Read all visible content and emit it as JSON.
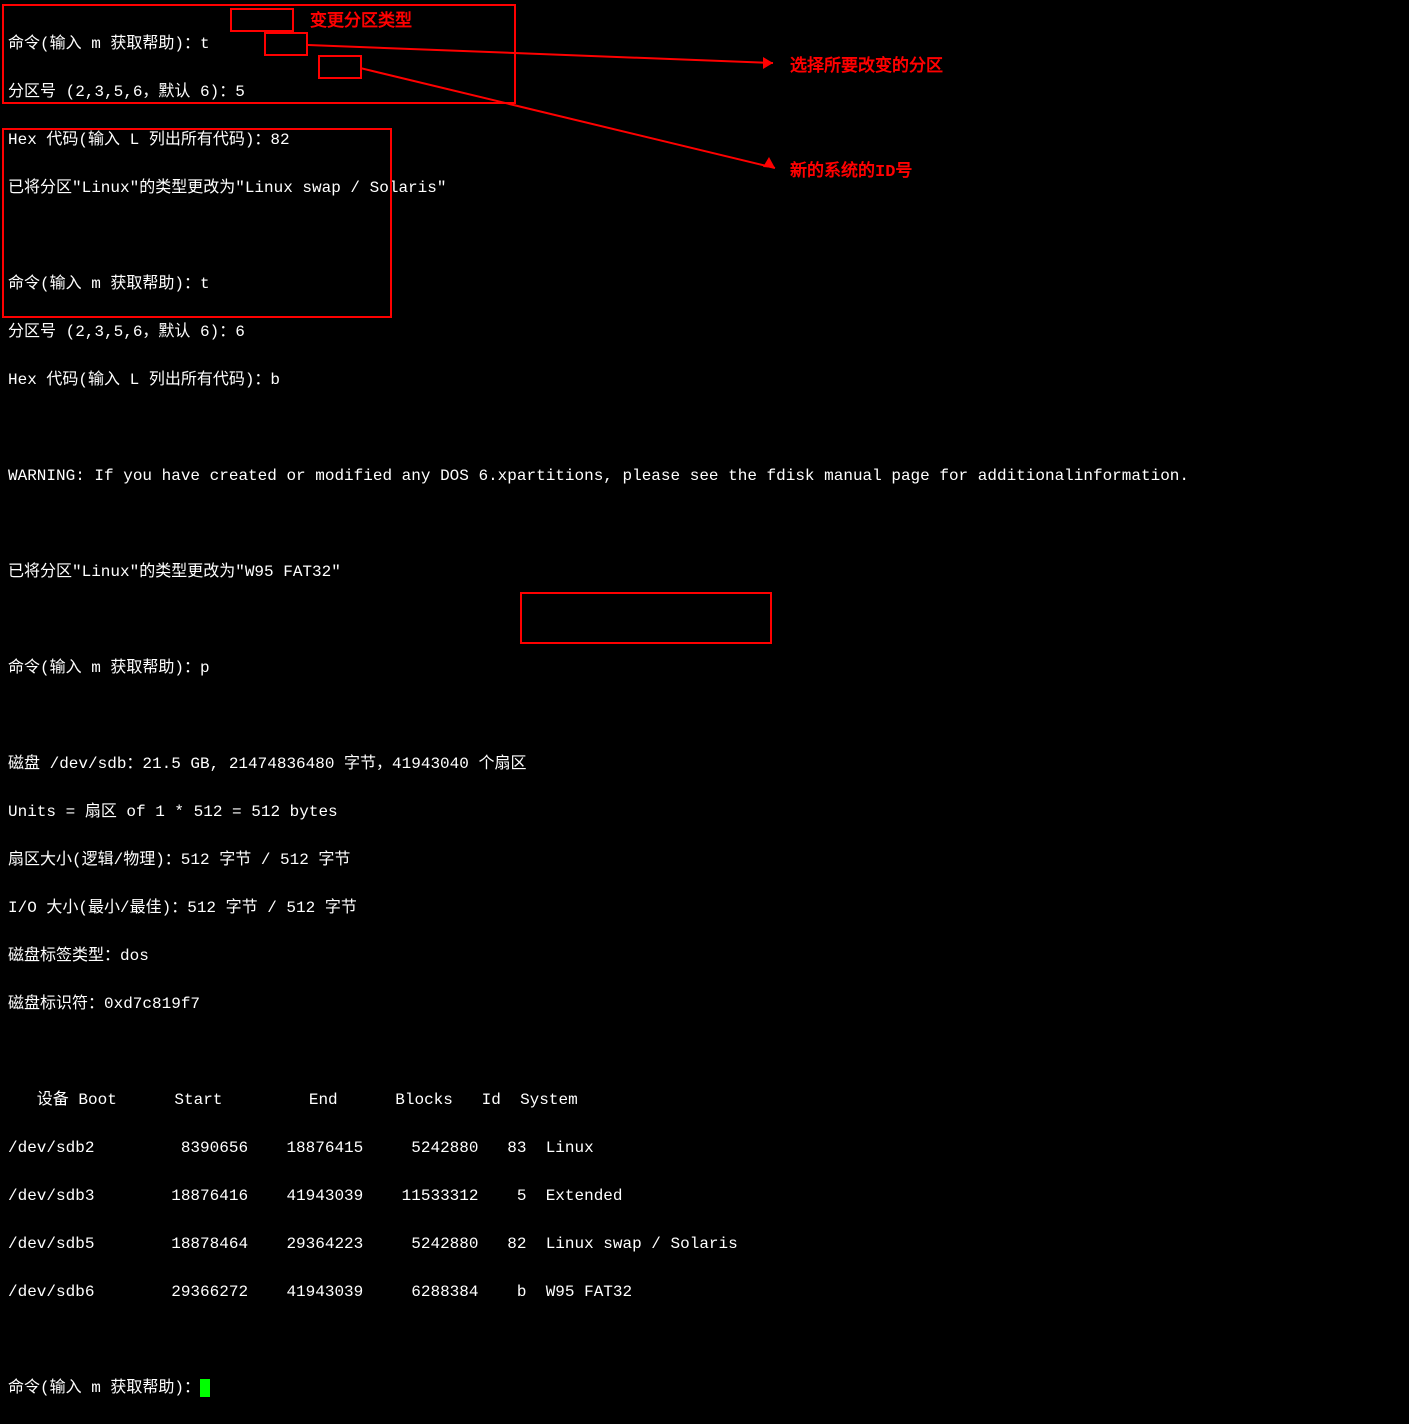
{
  "block1": {
    "line1_prompt": "命令(输入 m 获取帮助)：",
    "line1_input": "t",
    "line2_prompt": "分区号 (2,3,5,6，默认 6)：",
    "line2_input": "5",
    "line3_prompt": "Hex 代码(输入 L 列出所有代码)：",
    "line3_input": "82",
    "line4": "已将分区\"Linux\"的类型更改为\"Linux swap / Solaris\""
  },
  "block2": {
    "line1": "命令(输入 m 获取帮助)：t",
    "line2": "分区号 (2,3,5,6，默认 6)：6",
    "line3": "Hex 代码(输入 L 列出所有代码)：b",
    "warning": "WARNING: If you have created or modified any DOS 6.xpartitions, please see the fdisk manual page for additionalinformation.",
    "result": "已将分区\"Linux\"的类型更改为\"W95 FAT32\""
  },
  "cmd_p": "命令(输入 m 获取帮助)：p",
  "disk_info": {
    "line1": "磁盘 /dev/sdb：21.5 GB, 21474836480 字节，41943040 个扇区",
    "line2": "Units = 扇区 of 1 * 512 = 512 bytes",
    "line3": "扇区大小(逻辑/物理)：512 字节 / 512 字节",
    "line4": "I/O 大小(最小/最佳)：512 字节 / 512 字节",
    "line5": "磁盘标签类型：dos",
    "line6": "磁盘标识符：0xd7c819f7"
  },
  "table": {
    "header": "   设备 Boot      Start         End      Blocks   Id  System",
    "row1": "/dev/sdb2         8390656    18876415     5242880   83  Linux",
    "row2": "/dev/sdb3        18876416    41943039    11533312    5  Extended",
    "row3": "/dev/sdb5        18878464    29364223     5242880   82  Linux swap / Solaris",
    "row4": "/dev/sdb6        29366272    41943039     6288384    b  W95 FAT32"
  },
  "final_prompt": "命令(输入 m 获取帮助)：",
  "annotations": {
    "a1": "变更分区类型",
    "a2": "选择所要改变的分区",
    "a3": "新的系统的ID号"
  }
}
